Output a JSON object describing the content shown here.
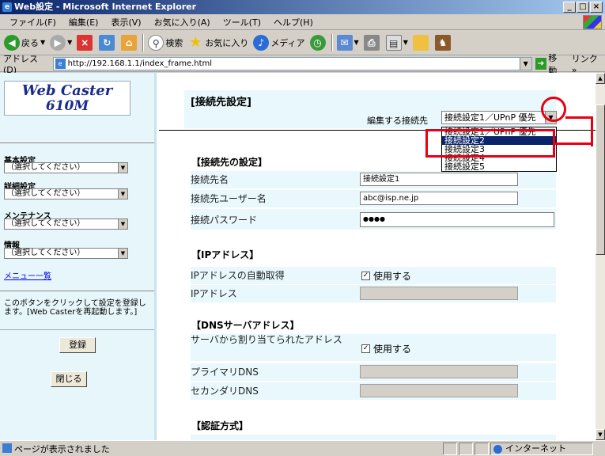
{
  "window": {
    "title": "Web設定 - Microsoft Internet Explorer"
  },
  "menu": [
    "ファイル(F)",
    "編集(E)",
    "表示(V)",
    "お気に入り(A)",
    "ツール(T)",
    "ヘルプ(H)"
  ],
  "toolbar": {
    "back": "戻る",
    "search": "検索",
    "favorites": "お気に入り",
    "media": "メディア"
  },
  "address": {
    "label": "アドレス(D)",
    "url": "http://192.168.1.1/index_frame.html",
    "go": "移動",
    "links": "リンク »"
  },
  "left": {
    "logo_line1": "Web Caster",
    "logo_line2": "610M",
    "sections": [
      {
        "title": "基本設定",
        "select": "（選択してください）"
      },
      {
        "title": "詳細設定",
        "select": "（選択してください）"
      },
      {
        "title": "メンテナンス",
        "select": "（選択してください）"
      },
      {
        "title": "情報",
        "select": "（選択してください）"
      }
    ],
    "menu_link": "メニュー一覧",
    "help": "このボタンをクリックして設定を登録します。[Web Casterを再起動します。]",
    "register": "登録",
    "close": "閉じる"
  },
  "main": {
    "header": "[接続先設定]",
    "edit_label": "編集する接続先",
    "edit_value": "接続設定1／UPnP 優先",
    "dropdown": [
      "接続設定1／UPnP 優先",
      "接続設定2",
      "接続設定3",
      "接続設定4",
      "接続設定5"
    ],
    "dropdown_selected": 1,
    "sec_connection": "【接続先の設定】",
    "conn_name_label": "接続先名",
    "conn_name_value": "接続設定1",
    "conn_user_label": "接続先ユーザー名",
    "conn_user_value": "abc@isp.ne.jp",
    "conn_pass_label": "接続パスワード",
    "conn_pass_value": "●●●●",
    "sec_ip": "【IPアドレス】",
    "ip_auto_label": "IPアドレスの自動取得",
    "ip_auto_check": "使用する",
    "ip_label": "IPアドレス",
    "sec_dns": "【DNSサーバアドレス】",
    "dns_assigned_label": "サーバから割り当てられたアドレス",
    "dns_assigned_check": "使用する",
    "dns_primary_label": "プライマリDNS",
    "dns_secondary_label": "セカンダリDNS",
    "sec_auth": "【認証方式】"
  },
  "status": {
    "message": "ページが表示されました",
    "zone": "インターネット"
  },
  "colors": {
    "annotation": "#e60012",
    "title_gradient_start": "#0a246a",
    "frame_bg": "#e8f8fc"
  }
}
